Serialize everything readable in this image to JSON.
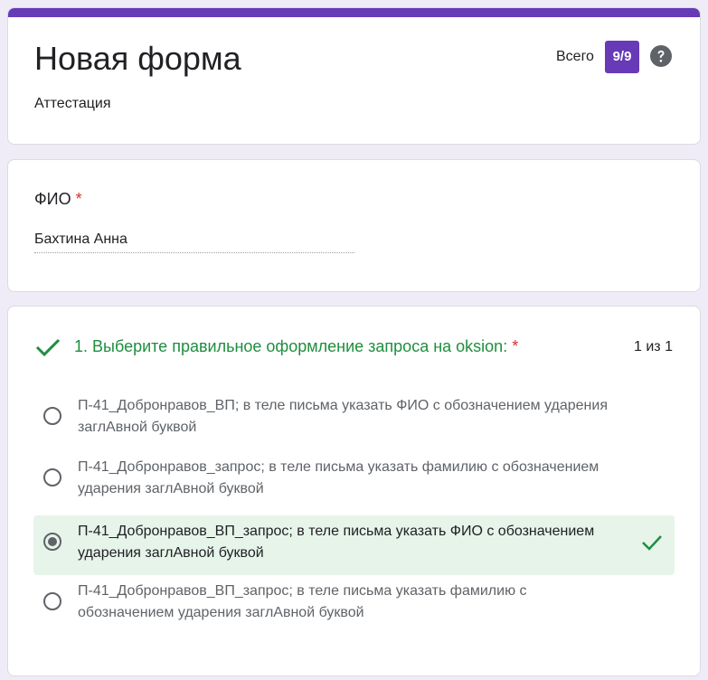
{
  "header": {
    "title": "Новая форма",
    "subtitle": "Аттестация",
    "score_label": "Всего",
    "score_value": "9/9",
    "accent_color": "#673ab7"
  },
  "fio": {
    "label": "ФИО",
    "required_mark": "*",
    "value": "Бахтина Анна"
  },
  "question": {
    "title": "1. Выберите правильное оформление запроса на oksion:",
    "required_mark": "*",
    "score": "1 из 1",
    "status_icon": "check-icon",
    "options": [
      {
        "label": "П-41_Добронравов_ВП; в теле письма указать ФИО с обозначением ударения заглАвной буквой",
        "selected": false
      },
      {
        "label": "П-41_Добронравов_запрос; в теле письма указать фамилию с обозначением ударения заглАвной буквой",
        "selected": false
      },
      {
        "label": "П-41_Добронравов_ВП_запрос; в теле письма указать ФИО с обозначением ударения заглАвной буквой",
        "selected": true,
        "correct": true
      },
      {
        "label": "П-41_Добронравов_ВП_запрос; в теле письма указать фамилию с обозначением ударения заглАвной буквой",
        "selected": false
      }
    ],
    "correct_color": "#1e8e3e"
  }
}
